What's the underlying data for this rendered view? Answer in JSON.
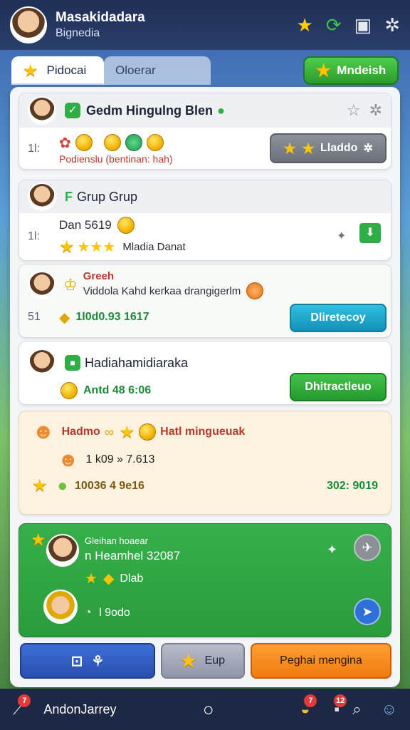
{
  "header": {
    "user_name": "Masakidadara",
    "user_sub": "Bignedia",
    "icons": [
      "star-icon",
      "refresh-icon",
      "inventory-icon",
      "settings-icon"
    ]
  },
  "tabs": [
    {
      "label": "Pidocai",
      "active": true
    },
    {
      "label": "Oloerar",
      "active": false
    }
  ],
  "top_button": {
    "label": "Mndeish"
  },
  "cards": {
    "c1": {
      "title": "Gedm Hingulng Blen",
      "side": "1l:",
      "red_text": "Podienslu  (bentinan: hah)",
      "button": "Lladdo"
    },
    "c2": {
      "title": "Grup Grup",
      "side": "1l:",
      "line1": "Dan 5619",
      "line2": "Mladia Danat"
    },
    "c3": {
      "title": "Greeh",
      "sub": "Viddola Kahd kerkaa drangigerlm",
      "side": "51",
      "value": "1l0d0.93 1617",
      "button": "Dliretecoy"
    },
    "c4": {
      "title": "Hadiahamidiaraka",
      "value": "Antd 48 6:06",
      "button": "Dhitractleuo"
    },
    "c5": {
      "line1": "Hadmo",
      "line1b": "Hatl mingueuak",
      "line2": "1 k09 » 7.613",
      "line3": "10036 4 9e16",
      "line3b": "302: 9019"
    },
    "c6": {
      "label": "Gleihan hoaear",
      "line1": "n Heamhel 32087",
      "line2": "Dlab",
      "line3": "l 9odo"
    }
  },
  "bottom_buttons": {
    "b2": "Eup",
    "b3": "Peghai mengina"
  },
  "navbar": {
    "label": "AndonJarrey",
    "badge1": "7",
    "badge2": "7",
    "badge3": "12"
  }
}
